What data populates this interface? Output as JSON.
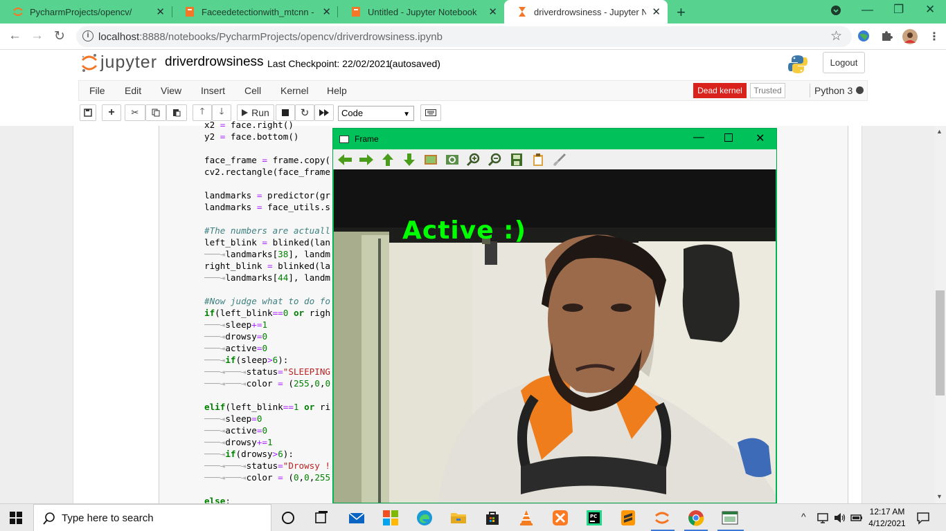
{
  "browser": {
    "tabs": [
      {
        "title": "PycharmProjects/opencv/",
        "icon": "jupyter-orange-icon"
      },
      {
        "title": "Faceedetectionwith_mtcnn - Jup",
        "icon": "jupyter-notebook-icon"
      },
      {
        "title": "Untitled - Jupyter Notebook",
        "icon": "jupyter-notebook-icon"
      },
      {
        "title": "driverdrowsiness - Jupyter Noteb",
        "icon": "hourglass-icon"
      }
    ],
    "url_host": "localhost",
    "url_rest": ":8888/notebooks/PycharmProjects/opencv/driverdrowsiness.ipynb"
  },
  "jupyter": {
    "logo_text": "jupyter",
    "notebook_name": "driverdrowsiness",
    "checkpoint": "Last Checkpoint: 22/02/2021",
    "autosaved": "(autosaved)",
    "logout": "Logout",
    "menus": [
      "File",
      "Edit",
      "View",
      "Insert",
      "Cell",
      "Kernel",
      "Help"
    ],
    "kernel_status": "Dead kernel",
    "trusted": "Trusted",
    "kernel_name": "Python 3",
    "run_label": "Run",
    "cell_type": "Code"
  },
  "frame_window": {
    "title": "Frame",
    "overlay_text": "Active :)"
  },
  "taskbar": {
    "search_placeholder": "Type here to search",
    "time": "12:17 AM",
    "date": "4/12/2021"
  },
  "colors": {
    "chrome_tab_bar": "#57d28f",
    "dead_kernel": "#d9221c",
    "frame_titlebar": "#00c15a",
    "overlay_text": "#00ff00"
  }
}
